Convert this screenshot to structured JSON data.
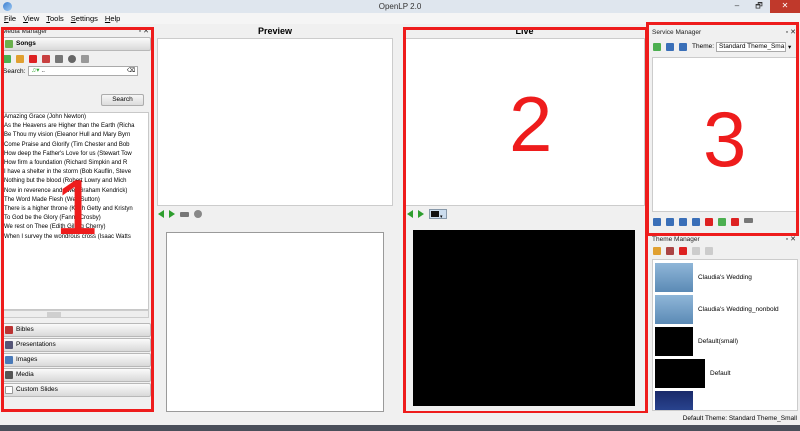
{
  "window": {
    "title": "OpenLP 2.0",
    "controls": [
      "–",
      "🗗",
      "✕"
    ]
  },
  "menu": [
    "File",
    "View",
    "Tools",
    "Settings",
    "Help"
  ],
  "media_manager": {
    "title": "Media Manager",
    "active_drawer": "Songs",
    "search_label": "Search:",
    "search_value": "..",
    "search_button": "Search",
    "songs": [
      "Amazing Grace (John Newton)",
      "As the Heavens are Higher than the Earth (Richa",
      "Be Thou my vision (Eleanor Hull and Mary Byrn",
      "Come Praise and Glorify (Tim Chester and Bob",
      "How deep the Father's Love for us (Stewart Tow",
      "How firm a foundation (Richard Simpkin and R",
      "I have a shelter in the storm (Bob Kauflin, Steve",
      "Nothing but the blood (Robert Lowry and Mich",
      "Now in reverence and awe (Graham Kendrick)",
      "The Word Made Flesh (Wes Sutton)",
      "There is a higher throne (Keith Getty and Kristyn",
      "To God be the Glory (Fanny Crosby)",
      "We rest on Thee (Edith Gilling Cherry)",
      "When I survey the wondrous cross (Isaac Watts"
    ],
    "drawers": [
      "Bibles",
      "Presentations",
      "Images",
      "Media",
      "Custom Slides"
    ]
  },
  "preview": {
    "title": "Preview"
  },
  "live": {
    "title": "Live"
  },
  "service_manager": {
    "title": "Service Manager",
    "theme_label": "Theme:",
    "theme_value": "Standard Theme_Sma"
  },
  "theme_manager": {
    "title": "Theme Manager",
    "themes": [
      "Claudia's Wedding",
      "Claudia's Wedding_nonbold",
      "Default(small)",
      "Default"
    ]
  },
  "status": {
    "default_theme": "Default Theme: Standard Theme_Small"
  },
  "annotations": [
    "1",
    "2",
    "3"
  ],
  "colors": {
    "annotation": "#ee1c1c",
    "live_screen": "#000000",
    "nav_green": "#2e9e2e"
  }
}
